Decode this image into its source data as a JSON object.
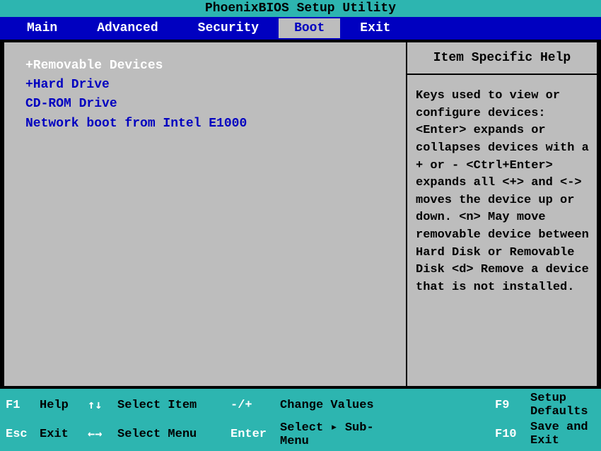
{
  "title": "PhoenixBIOS Setup Utility",
  "tabs": {
    "main": "Main",
    "advanced": "Advanced",
    "security": "Security",
    "boot": "Boot",
    "exit": "Exit"
  },
  "boot_items": {
    "removable": "+Removable Devices",
    "harddrive": "+Hard Drive",
    "cdrom": " CD-ROM Drive",
    "network": " Network boot from Intel E1000"
  },
  "help": {
    "title": "Item Specific Help",
    "content": "Keys used to view or configure devices:\n<Enter> expands or collapses devices with a + or -\n<Ctrl+Enter> expands all\n<+> and <-> moves the device up or down.\n<n> May move removable device between Hard Disk or Removable Disk\n<d> Remove a device that is not installed."
  },
  "footer": {
    "f1_key": "F1",
    "f1_action": "Help",
    "updown_key": "↑↓",
    "updown_action": "Select Item",
    "plusminus_key": "-/+",
    "plusminus_action": "Change Values",
    "f9_key": "F9",
    "f9_action": "Setup Defaults",
    "esc_key": "Esc",
    "esc_action": "Exit",
    "leftright_key": "←→",
    "leftright_action": "Select Menu",
    "enter_key": "Enter",
    "enter_action": "Select ▸ Sub-Menu",
    "f10_key": "F10",
    "f10_action": "Save and Exit"
  }
}
